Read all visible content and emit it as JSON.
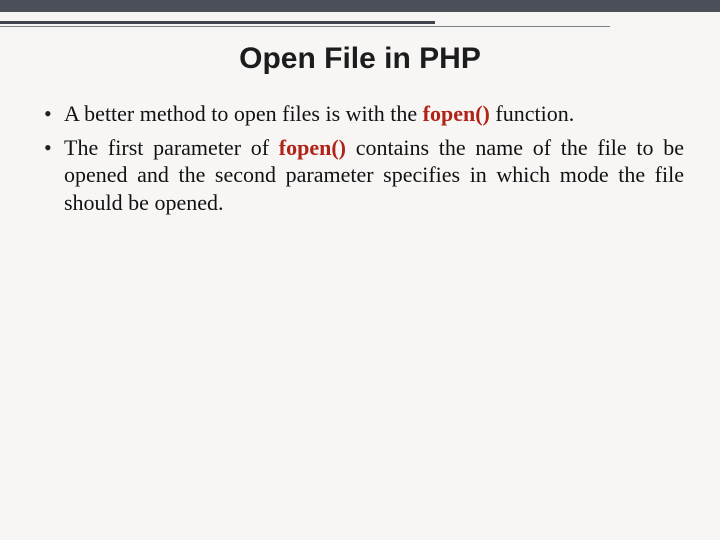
{
  "title": "Open File in PHP",
  "keyword": "fopen()",
  "bullets": {
    "b1": {
      "pre": "A better method to open files is with the ",
      "post": " function."
    },
    "b2": {
      "pre": "The first parameter of ",
      "post": " contains the name of the file to be opened and the second parameter specifies in which mode the file should be opened."
    }
  }
}
